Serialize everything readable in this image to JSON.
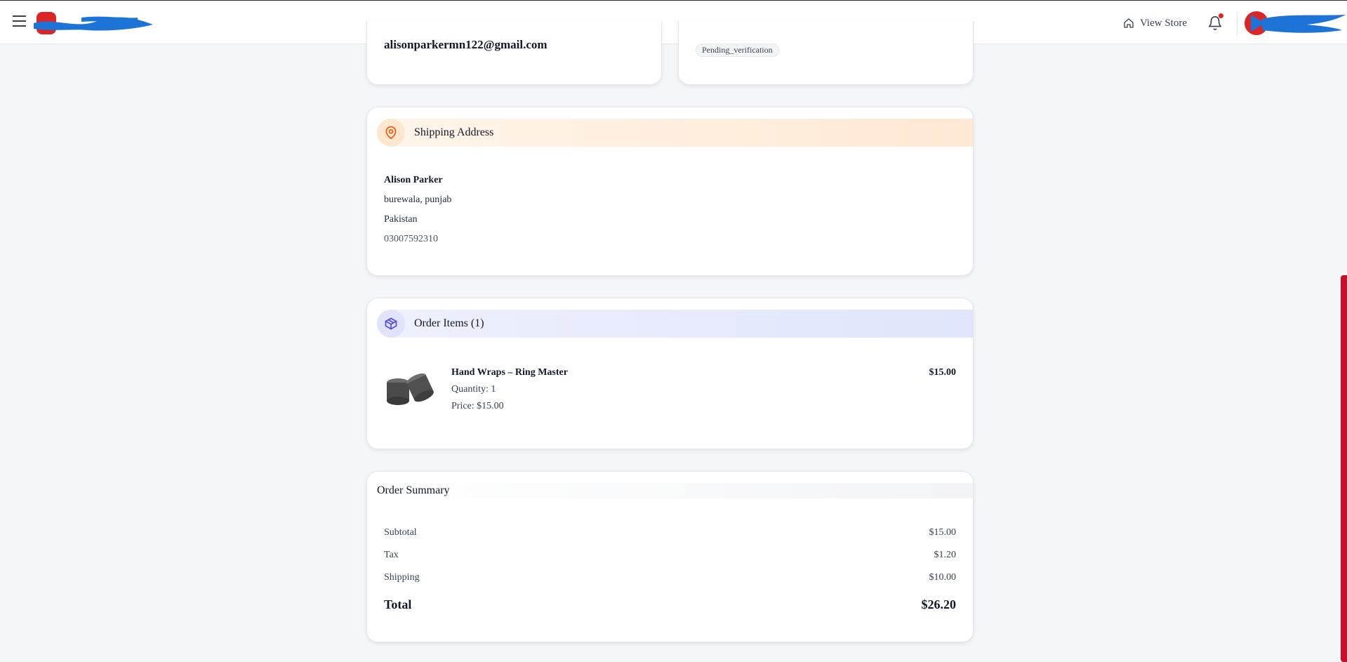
{
  "header": {
    "view_store_label": "View Store",
    "icons": {
      "menu": "hamburger-icon",
      "store": "home-icon",
      "notifications": "bell-icon"
    },
    "colors": {
      "notification_dot": "#dc2626",
      "brand_red": "#dc2626",
      "redaction_blue": "#1d74d6"
    }
  },
  "customer_card": {
    "email": "alisonparkermn122@gmail.com"
  },
  "status_card": {
    "status": "Pending_verification"
  },
  "shipping": {
    "title": "Shipping Address",
    "icon": "map-pin-icon",
    "accent": "#ea580c",
    "name": "Alison Parker",
    "address_line": "burewala, punjab",
    "country": "Pakistan",
    "phone": "03007592310"
  },
  "order_items": {
    "title": "Order Items (1)",
    "icon": "package-icon",
    "accent": "#4f46e5",
    "items": [
      {
        "name": "Hand Wraps – Ring Master",
        "quantity": "Quantity: 1",
        "price": "Price: $15.00",
        "line_total": "$15.00"
      }
    ]
  },
  "summary": {
    "title": "Order Summary",
    "subtotal_label": "Subtotal",
    "subtotal": "$15.00",
    "tax_label": "Tax",
    "tax": "$1.20",
    "shipping_label": "Shipping",
    "shipping": "$10.00",
    "total_label": "Total",
    "total": "$26.20"
  },
  "scrollbar": {
    "color": "#c8102e"
  }
}
